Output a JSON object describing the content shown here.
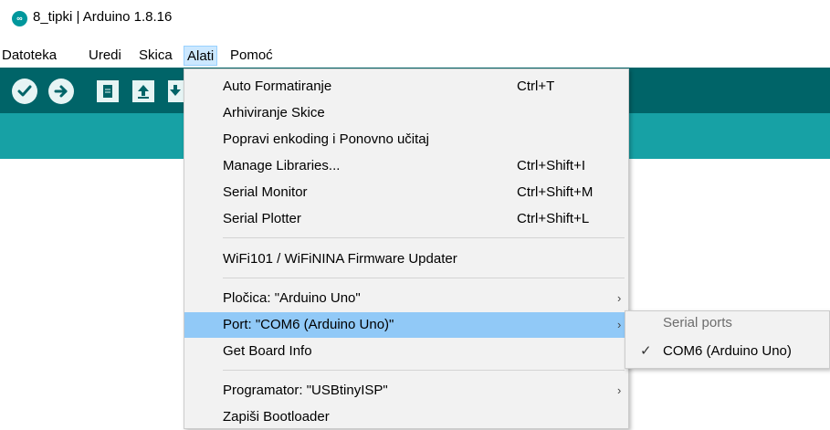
{
  "window": {
    "title": "8_tipki | Arduino 1.8.16",
    "logo_icon": "arduino-logo-icon"
  },
  "menubar": {
    "items": [
      "Datoteka",
      "Uredi",
      "Skica",
      "Alati",
      "Pomoć"
    ],
    "active": "Alati"
  },
  "toolbar": {
    "buttons": [
      "verify-icon",
      "upload-icon",
      "new-icon",
      "open-icon",
      "save-icon"
    ],
    "colors": {
      "toolbar": "#006468",
      "tabbar": "#17a1a5"
    }
  },
  "tools_menu": {
    "items": [
      {
        "label": "Auto Formatiranje",
        "shortcut": "Ctrl+T"
      },
      {
        "label": "Arhiviranje Skice",
        "shortcut": ""
      },
      {
        "label": "Popravi enkoding i Ponovno učitaj",
        "shortcut": ""
      },
      {
        "label": "Manage Libraries...",
        "shortcut": "Ctrl+Shift+I"
      },
      {
        "label": "Serial Monitor",
        "shortcut": "Ctrl+Shift+M"
      },
      {
        "label": "Serial Plotter",
        "shortcut": "Ctrl+Shift+L"
      },
      {
        "label": "WiFi101 / WiFiNINA Firmware Updater",
        "shortcut": ""
      },
      {
        "label": "Pločica: \"Arduino Uno\"",
        "shortcut": ""
      },
      {
        "label": "Port: \"COM6 (Arduino Uno)\"",
        "shortcut": ""
      },
      {
        "label": "Get Board Info",
        "shortcut": ""
      },
      {
        "label": "Programator: \"USBtinyISP\"",
        "shortcut": ""
      },
      {
        "label": "Zapiši Bootloader",
        "shortcut": ""
      }
    ],
    "highlighted": "Port: \"COM6 (Arduino Uno)\"",
    "highlight_color": "#91c9f7"
  },
  "port_submenu": {
    "header": "Serial ports",
    "items": [
      {
        "label": "COM6 (Arduino Uno)",
        "checked": true
      }
    ]
  }
}
